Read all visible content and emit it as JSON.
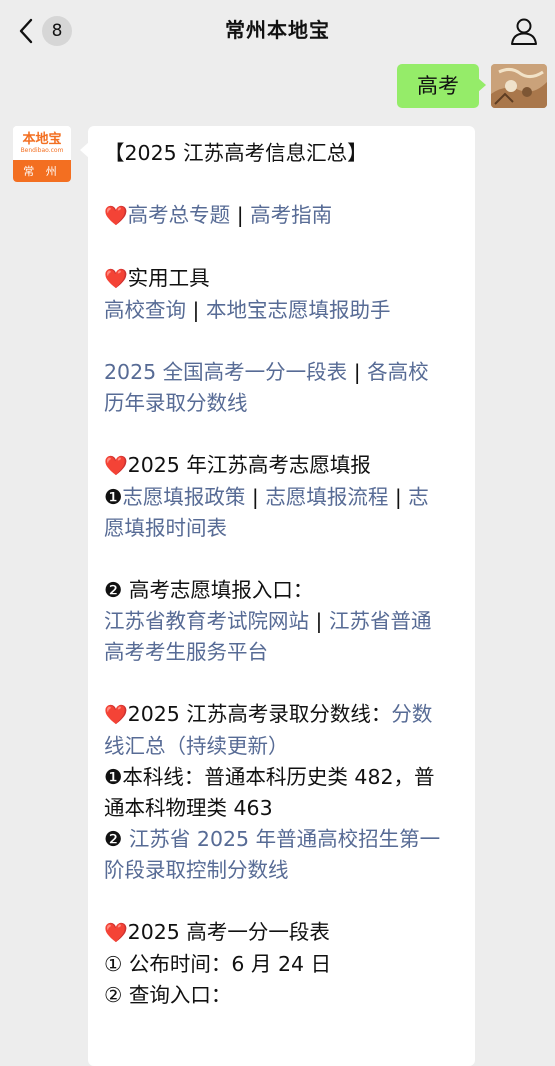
{
  "nav": {
    "title": "常州本地宝",
    "unread_count": "8"
  },
  "outgoing": {
    "text": "高考"
  },
  "account_logo": {
    "main": "本地宝",
    "sub": "Bendibao.com",
    "city": "常 州"
  },
  "message": {
    "title": "【2025 江苏高考信息汇总】",
    "heart": "❤️",
    "section1": {
      "link1": "高考总专题",
      "sep": " | ",
      "link2": "高考指南"
    },
    "section2": {
      "title": "实用工具",
      "link1": "高校查询",
      "sep": " | ",
      "link2": "本地宝志愿填报助手"
    },
    "section3": {
      "line1": "2025 全国高考一分一段表",
      "sep": " | ",
      "line1b": "各高校",
      "line2": "历年录取分数线"
    },
    "section4": {
      "title": "2025 年江苏高考志愿填报",
      "bullet1": "❶",
      "link1": "志愿填报政策",
      "sep": " | ",
      "link2": "志愿填报流程",
      "link3a": "志",
      "link3b": "愿填报时间表",
      "bullet2": "❷",
      "entry_label": " 高考志愿填报入口：",
      "link4": "江苏省教育考试院网站",
      "link5a": "江苏省普通",
      "link5b": "高考考生服务平台"
    },
    "section5": {
      "title": "2025 江苏高考录取分数线：",
      "link1a": "分数",
      "link1b": "线汇总（持续更新）",
      "bullet1": "❶",
      "text1a": "本科线：普通本科历史类 482，普",
      "text1b": "通本科物理类 463",
      "bullet2": "❷",
      "link2a": " 江苏省 2025 年普通高校招生第一",
      "link2b": "阶段录取控制分数线"
    },
    "section6": {
      "title": "2025 高考一分一段表",
      "item1": "① 公布时间：6 月 24 日",
      "item2": "② 查询入口："
    }
  },
  "colors": {
    "background": "#ededed",
    "bubble_out": "#95ec69",
    "bubble_in": "#ffffff",
    "link": "#576b95",
    "brand_orange": "#f36f21",
    "heart": "#e0232f"
  }
}
